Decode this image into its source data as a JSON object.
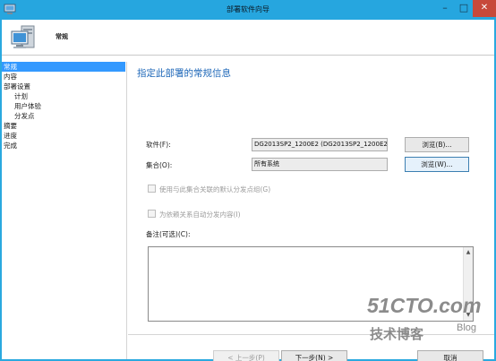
{
  "window": {
    "title": "部署软件向导",
    "minimize_icon": "minimize-icon",
    "maximize_icon": "maximize-icon",
    "close_icon": "close-icon"
  },
  "header": {
    "title": "常规",
    "icon": "computer-icon"
  },
  "nav": {
    "items": [
      {
        "label": "常规",
        "selected": true
      },
      {
        "label": "内容",
        "selected": false
      },
      {
        "label": "部署设置",
        "selected": false
      },
      {
        "label": "计划",
        "selected": false
      },
      {
        "label": "用户体验",
        "selected": false
      },
      {
        "label": "分发点",
        "selected": false
      },
      {
        "label": "摘要",
        "selected": false
      },
      {
        "label": "进度",
        "selected": false
      },
      {
        "label": "完成",
        "selected": false
      }
    ]
  },
  "main": {
    "heading": "指定此部署的常规信息",
    "software_label": "软件(F):",
    "software_value": "DG2013SP2_1200E2 (DG2013SP2_1200E2)",
    "software_browse": "浏览(B)...",
    "collection_label": "集合(O):",
    "collection_value": "所有系统",
    "collection_browse": "浏览(W)...",
    "option_default_dp_group": "使用与此集合关联的默认分发点组(G)",
    "option_auto_distribute": "为依赖关系自动分发内容(I)",
    "notes_label": "备注(可选)(C):",
    "notes_value": ""
  },
  "footer": {
    "prev_button": "< 上一步(P)",
    "next_button": "下一步(N) >",
    "cancel_button": "取消"
  },
  "watermark": {
    "line1": "51CTO.com",
    "line2": "技术博客",
    "line3": "Blog"
  },
  "colors": {
    "titlebar": "#26a6df",
    "selection": "#3399ff",
    "heading": "#1e67b8",
    "close_button": "#c7493a"
  }
}
